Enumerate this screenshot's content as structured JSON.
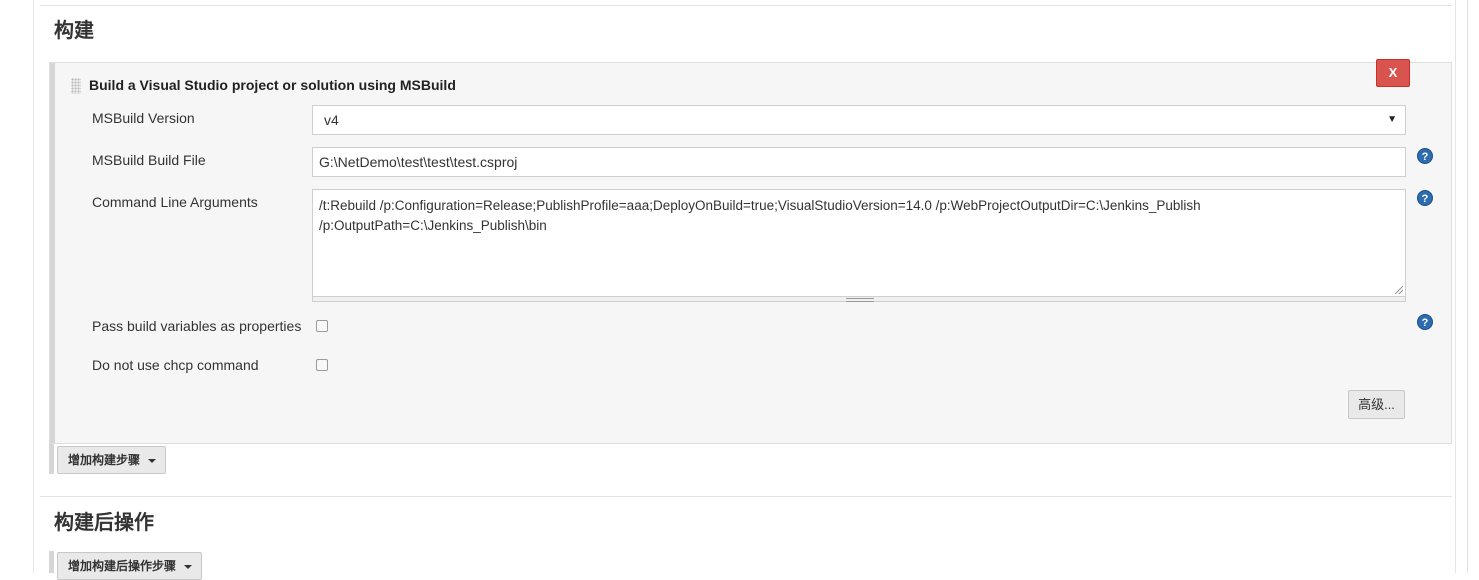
{
  "build_section": {
    "title": "构建"
  },
  "msbuild_step": {
    "title": "Build a Visual Studio project or solution using MSBuild",
    "delete_label": "X",
    "version_label": "MSBuild Version",
    "version_value": "v4",
    "build_file_label": "MSBuild Build File",
    "build_file_value": "G:\\NetDemo\\test\\test\\test.csproj",
    "args_label": "Command Line Arguments",
    "args_value": "/t:Rebuild /p:Configuration=Release;PublishProfile=aaa;DeployOnBuild=true;VisualStudioVersion=14.0 /p:WebProjectOutputDir=C:\\Jenkins_Publish /p:OutputPath=C:\\Jenkins_Publish\\bin",
    "pass_vars_label": "Pass build variables as properties",
    "pass_vars_checked": false,
    "no_chcp_label": "Do not use chcp command",
    "no_chcp_checked": false,
    "advanced_label": "高级..."
  },
  "add_build_step_label": "增加构建步骤",
  "post_build_section": {
    "title": "构建后操作",
    "add_post_step_label": "增加构建后操作步骤"
  },
  "icons": {
    "help": "help-icon",
    "select_arrow": "▼",
    "help_glyph": "?"
  },
  "colors": {
    "delete_button": "#d9534f",
    "help_icon": "#2e6cb0",
    "panel_background": "#f6f6f6"
  }
}
